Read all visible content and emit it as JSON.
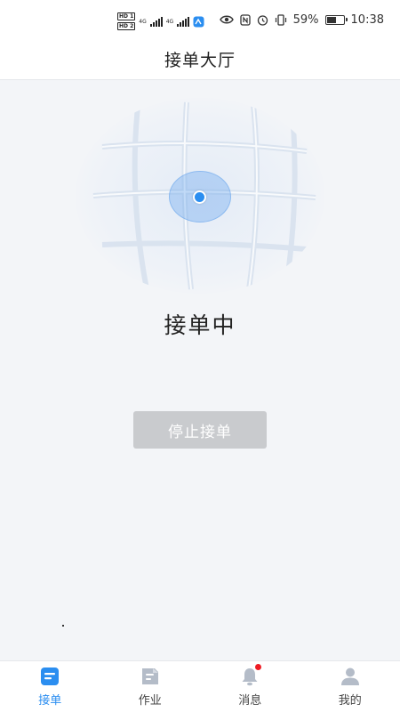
{
  "status_bar": {
    "sim1": "HD 1",
    "sim2": "HD 2",
    "net1": "4G",
    "net2": "4G",
    "battery_percent": "59%",
    "battery_level": 0.59,
    "time": "10:38"
  },
  "header": {
    "title": "接单大厅"
  },
  "main": {
    "status_text": "接单中",
    "stop_button_label": "停止接单"
  },
  "bottom_nav": {
    "items": [
      {
        "label": "接单",
        "icon": "order-icon",
        "active": true
      },
      {
        "label": "作业",
        "icon": "task-icon",
        "active": false
      },
      {
        "label": "消息",
        "icon": "bell-icon",
        "active": false,
        "badge": true
      },
      {
        "label": "我的",
        "icon": "user-icon",
        "active": false
      }
    ]
  },
  "colors": {
    "accent": "#2b8ef0",
    "button_disabled": "#c9cbce",
    "badge": "#ee1c24",
    "inactive_icon": "#b4bcc8"
  }
}
